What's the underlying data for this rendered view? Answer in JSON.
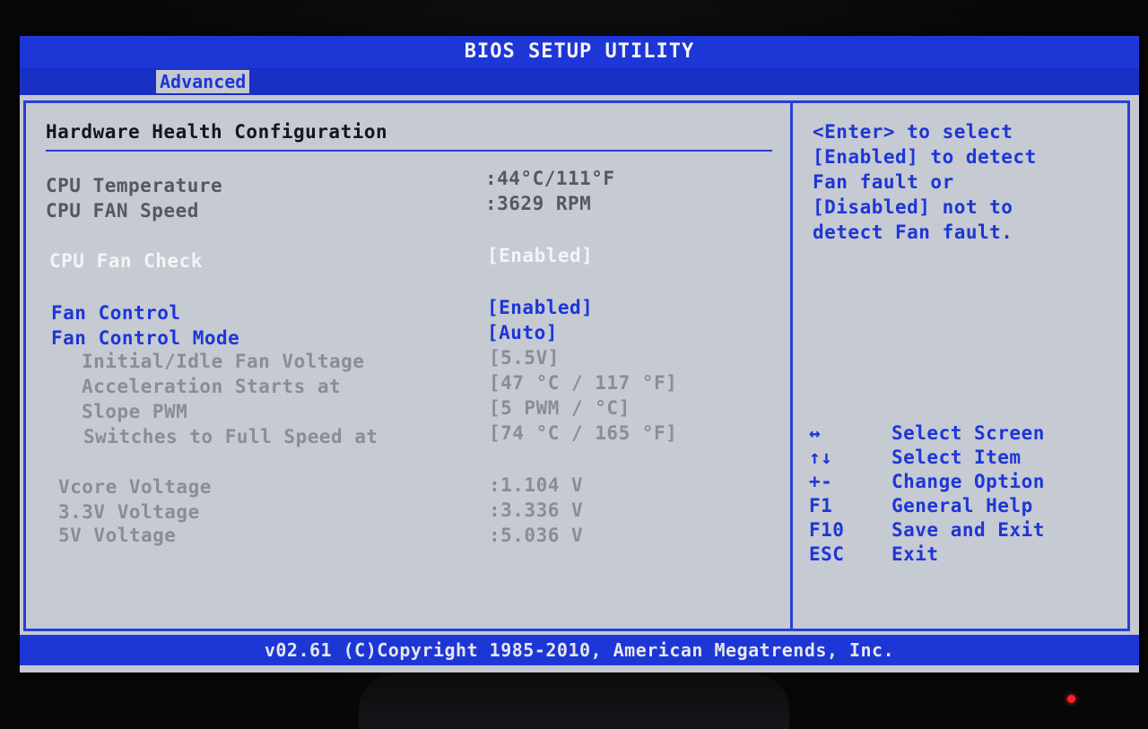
{
  "window": {
    "title": "BIOS SETUP UTILITY",
    "tabs": [
      {
        "label": "Advanced",
        "active": true
      }
    ]
  },
  "page": {
    "title": "Hardware Health Configuration"
  },
  "monitoring": {
    "cpu_temperature": {
      "label": "CPU Temperature",
      "value": ":44°C/111°F"
    },
    "cpu_fan_speed": {
      "label": "CPU FAN Speed",
      "value": ":3629 RPM"
    }
  },
  "settings": {
    "cpu_fan_check": {
      "label": "CPU Fan Check",
      "value": "[Enabled]"
    },
    "fan_control": {
      "label": "Fan Control",
      "value": "[Enabled]"
    },
    "fan_control_mode": {
      "label": "Fan Control Mode",
      "value": "[Auto]"
    },
    "initial_idle_fan_voltage": {
      "label": "Initial/Idle Fan Voltage",
      "value": "[5.5V]"
    },
    "acceleration_starts_at": {
      "label": "Acceleration Starts at",
      "value": "[47 °C / 117 °F]"
    },
    "slope_pwm": {
      "label": "Slope PWM",
      "value": "[5  PWM / °C]"
    },
    "switches_full_speed": {
      "label": "Switches to Full Speed at",
      "value": "[74 °C / 165 °F]"
    }
  },
  "voltages": {
    "vcore": {
      "label": "Vcore Voltage",
      "value": ":1.104 V"
    },
    "v33": {
      "label": "3.3V Voltage",
      "value": ":3.336 V"
    },
    "v5": {
      "label": "5V Voltage",
      "value": ":5.036 V"
    }
  },
  "help": {
    "lines": [
      "<Enter> to select",
      "[Enabled] to detect",
      "Fan fault or",
      "[Disabled] not to",
      "detect Fan fault."
    ]
  },
  "keys": [
    {
      "key": "↔",
      "action": "Select Screen"
    },
    {
      "key": "↑↓",
      "action": "Select Item"
    },
    {
      "key": "+-",
      "action": "Change Option"
    },
    {
      "key": "F1",
      "action": "General Help"
    },
    {
      "key": "F10",
      "action": "Save and Exit"
    },
    {
      "key": "ESC",
      "action": "Exit"
    }
  ],
  "footer": {
    "text": "v02.61 (C)Copyright 1985-2010, American Megatrends, Inc."
  },
  "colors": {
    "bios_blue": "#1d36d6",
    "panel_gray": "#c6cad2",
    "highlight_white": "#f4f4f6",
    "power_led": "#ff2020"
  }
}
